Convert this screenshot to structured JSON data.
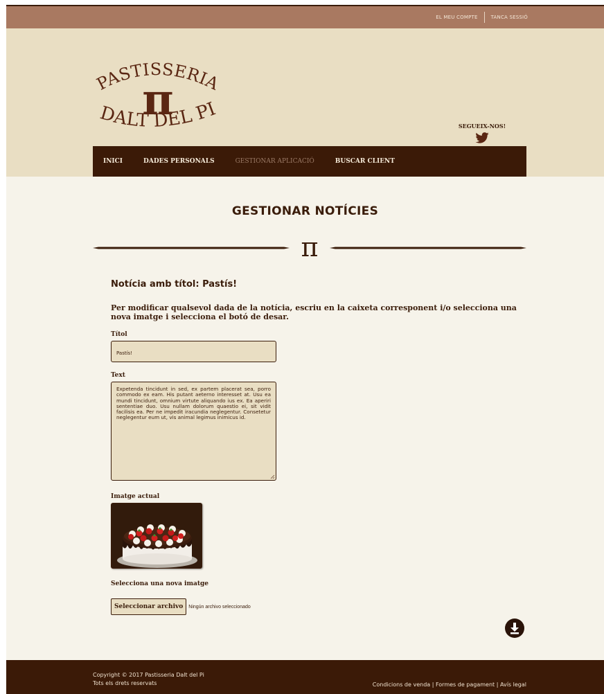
{
  "topbar": {
    "account_label": "EL MEU COMPTE",
    "logout_label": "TANCA SESSIÓ"
  },
  "logo": {
    "line1": "PASTISSERIA",
    "symbol": "π",
    "line2": "DALT DEL PI"
  },
  "social": {
    "follow_label": "SEGUEIX-NOS!",
    "icon": "twitter-icon"
  },
  "nav": {
    "items": [
      {
        "label": "INICI"
      },
      {
        "label": "DADES PERSONALS"
      },
      {
        "label": "GESTIONAR APLICACIÓ"
      },
      {
        "label": "BUSCAR CLIENT"
      }
    ],
    "active_index": 2
  },
  "main": {
    "page_title": "GESTIONAR NOTÍCIES",
    "divider_symbol": "π",
    "news_heading": "Notícia amb títol: Pastís!",
    "instructions": "Per modificar qualsevol dada de la notícia, escriu en la caixeta corresponent i/o selecciona una nova imatge i selecciona el botó de desar.",
    "title_field": {
      "label": "Títol",
      "value": "Pastís!"
    },
    "text_field": {
      "label": "Text",
      "value": "Expetenda tincidunt in sed, ex partem placerat sea, porro commodo ex eam. His putant aeterno interesset at. Usu ea mundi tincidunt, omnium virtute aliquando ius ex. Ea aperiri sententiae duo. Usu nullam dolorum quaestio ei, sit vidit facilisis ea. Per ne impedit iracundia neglegentur. Consetetur neglegentur eum ut, vis animal legimus inimicus id."
    },
    "current_image_label": "Imatge actual",
    "new_image_label": "Selecciona una nova imatge",
    "file_button_label": "Seleccionar archivo",
    "file_status": "Ningún archivo seleccionado",
    "save_icon": "download-icon"
  },
  "footer": {
    "copyright": "Copyright © 2017 Pastisseria Dalt del Pi",
    "rights": "Tots els drets reservats",
    "links": [
      "Condicions de venda",
      "Formes de pagament",
      "Avís legal"
    ],
    "separator": " | "
  },
  "colors": {
    "brown_dark": "#3b1a07",
    "topbar": "#a97961",
    "header_bg": "#e9dec3",
    "page_bg": "#f6f3ea"
  }
}
